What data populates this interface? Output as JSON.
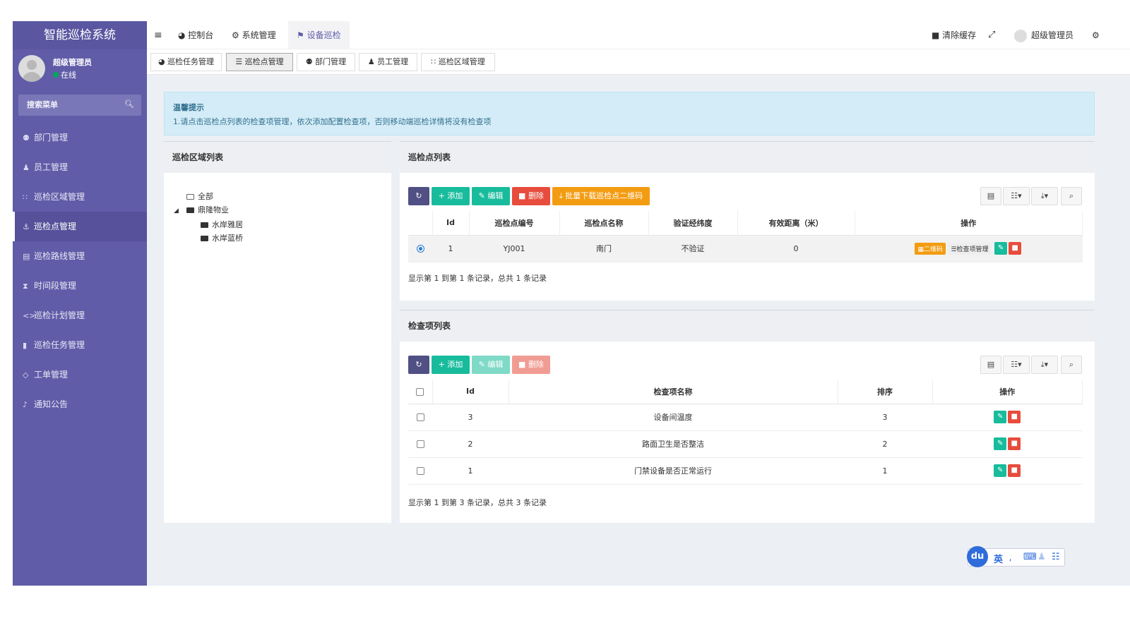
{
  "app": {
    "title": "智能巡检系统"
  },
  "user": {
    "name": "超级管理员",
    "status": "在线"
  },
  "sidebar": {
    "search_placeholder": "搜索菜单",
    "items": [
      {
        "label": "部门管理",
        "icon": "users-icon"
      },
      {
        "label": "员工管理",
        "icon": "user-icon"
      },
      {
        "label": "巡检区域管理",
        "icon": "grid-icon"
      },
      {
        "label": "巡检点管理",
        "icon": "anchor-icon",
        "active": true
      },
      {
        "label": "巡检路线管理",
        "icon": "map-icon"
      },
      {
        "label": "时间段管理",
        "icon": "hourglass-icon"
      },
      {
        "label": "巡检计划管理",
        "icon": "code-icon"
      },
      {
        "label": "巡检任务管理",
        "icon": "bookmark-icon"
      },
      {
        "label": "工单管理",
        "icon": "diamond-icon"
      },
      {
        "label": "通知公告",
        "icon": "bell-icon"
      }
    ]
  },
  "topbar": {
    "nav": [
      "控制台",
      "系统管理",
      "设备巡检"
    ],
    "clear_cache": "清除缓存",
    "user": "超级管理员"
  },
  "page_tabs": [
    "巡检任务管理",
    "巡检点管理",
    "部门管理",
    "员工管理",
    "巡检区域管理"
  ],
  "callout": {
    "title": "温馨提示",
    "text": "1.请点击巡检点列表的检查项管理，依次添加配置检查项，否则移动端巡检详情将没有检查项"
  },
  "area_panel": {
    "title": "巡检区域列表",
    "tree": {
      "root": "全部",
      "node": "鼎隆物业",
      "children": [
        "水岸雅居",
        "水岸蓝桥"
      ]
    }
  },
  "point_panel": {
    "title": "巡检点列表",
    "buttons": {
      "add": "添加",
      "edit": "编辑",
      "delete": "删除",
      "download": "批量下载巡检点二维码"
    },
    "columns": [
      "Id",
      "巡检点编号",
      "巡检点名称",
      "验证经纬度",
      "有效距离（米）",
      "操作"
    ],
    "rows": [
      {
        "id": "1",
        "code": "YJ001",
        "name": "南门",
        "verify": "不验证",
        "distance": "0",
        "qr": "二维码",
        "manage": "检查项管理"
      }
    ],
    "footer": "显示第 1 到第 1 条记录，总共 1 条记录"
  },
  "check_panel": {
    "title": "检查项列表",
    "buttons": {
      "add": "添加",
      "edit": "编辑",
      "delete": "删除"
    },
    "columns": [
      "Id",
      "检查项名称",
      "排序",
      "操作"
    ],
    "rows": [
      {
        "id": "3",
        "name": "设备间温度",
        "order": "3"
      },
      {
        "id": "2",
        "name": "路面卫生是否整洁",
        "order": "2"
      },
      {
        "id": "1",
        "name": "门禁设备是否正常运行",
        "order": "1"
      }
    ],
    "footer": "显示第 1 到第 3 条记录，总共 3 条记录"
  },
  "ime": {
    "logo": "du",
    "lang": "英"
  },
  "colors": {
    "sidebar": "#605ca8",
    "primary_green": "#18bc9c",
    "danger": "#e74c3c",
    "warning": "#f39c12"
  }
}
